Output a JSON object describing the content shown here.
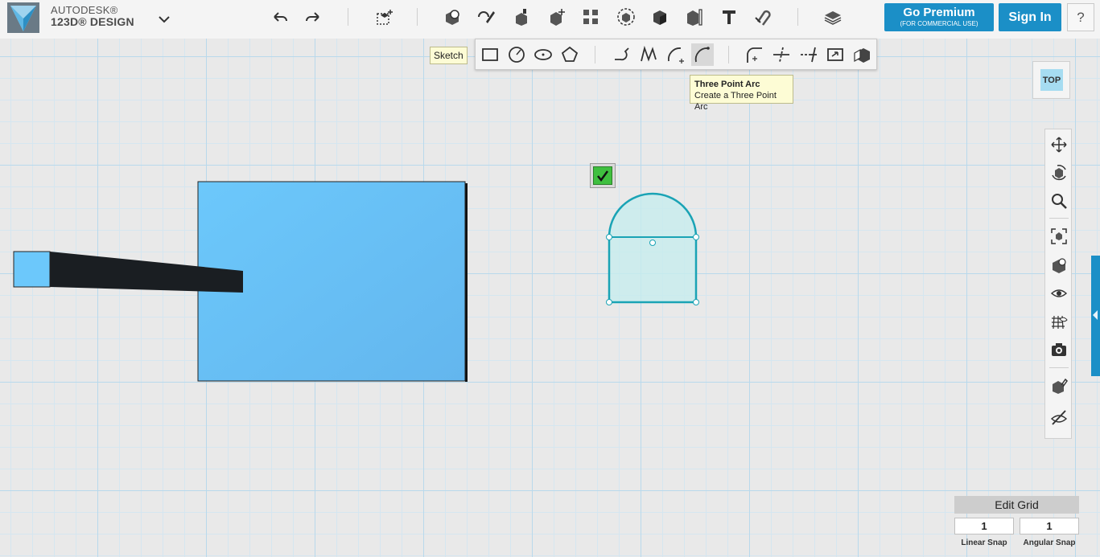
{
  "app": {
    "brand_line1": "AUTODESK®",
    "brand_line2": "123D® DESIGN"
  },
  "toolbar": {
    "premium_label": "Go Premium",
    "premium_sub": "(FOR COMMERCIAL USE)",
    "signin_label": "Sign In",
    "help_label": "?",
    "tools": [
      "undo-icon",
      "redo-icon",
      "transform-icon",
      "primitives-icon",
      "sketch-icon",
      "construct-icon",
      "modify-icon",
      "pattern-icon",
      "grouping-icon",
      "combine-icon",
      "measure-icon",
      "text-icon",
      "snap-icon",
      "materials-icon"
    ]
  },
  "sketch_menu": {
    "label": "Sketch",
    "tools": [
      "rectangle-icon",
      "circle-icon",
      "ellipse-icon",
      "polygon-icon",
      "polyline-icon",
      "spline-icon",
      "two-point-arc-icon",
      "three-point-arc-icon",
      "fillet-icon",
      "trim-icon",
      "extend-icon",
      "offset-icon",
      "project-icon"
    ],
    "active": "three-point-arc-icon"
  },
  "tooltip": {
    "title": "Three Point Arc",
    "description": "Create a Three Point Arc"
  },
  "viewcube": {
    "face": "TOP"
  },
  "navigation": [
    "pan-icon",
    "orbit-icon",
    "zoom-icon",
    "fit-icon",
    "view-mode-icon",
    "visibility-icon",
    "grid-icon",
    "screenshot-icon",
    "material-display-icon",
    "hide-icon"
  ],
  "edit_grid": {
    "title": "Edit Grid",
    "linear_snap_value": "1",
    "linear_snap_label": "Linear Snap",
    "angular_snap_value": "1",
    "angular_snap_label": "Angular Snap"
  },
  "colors": {
    "accent": "#1b8fc7",
    "solid_face": "#68c4f8",
    "sketch_stroke": "#1aa3b5",
    "sketch_fill": "#c7ecee"
  }
}
